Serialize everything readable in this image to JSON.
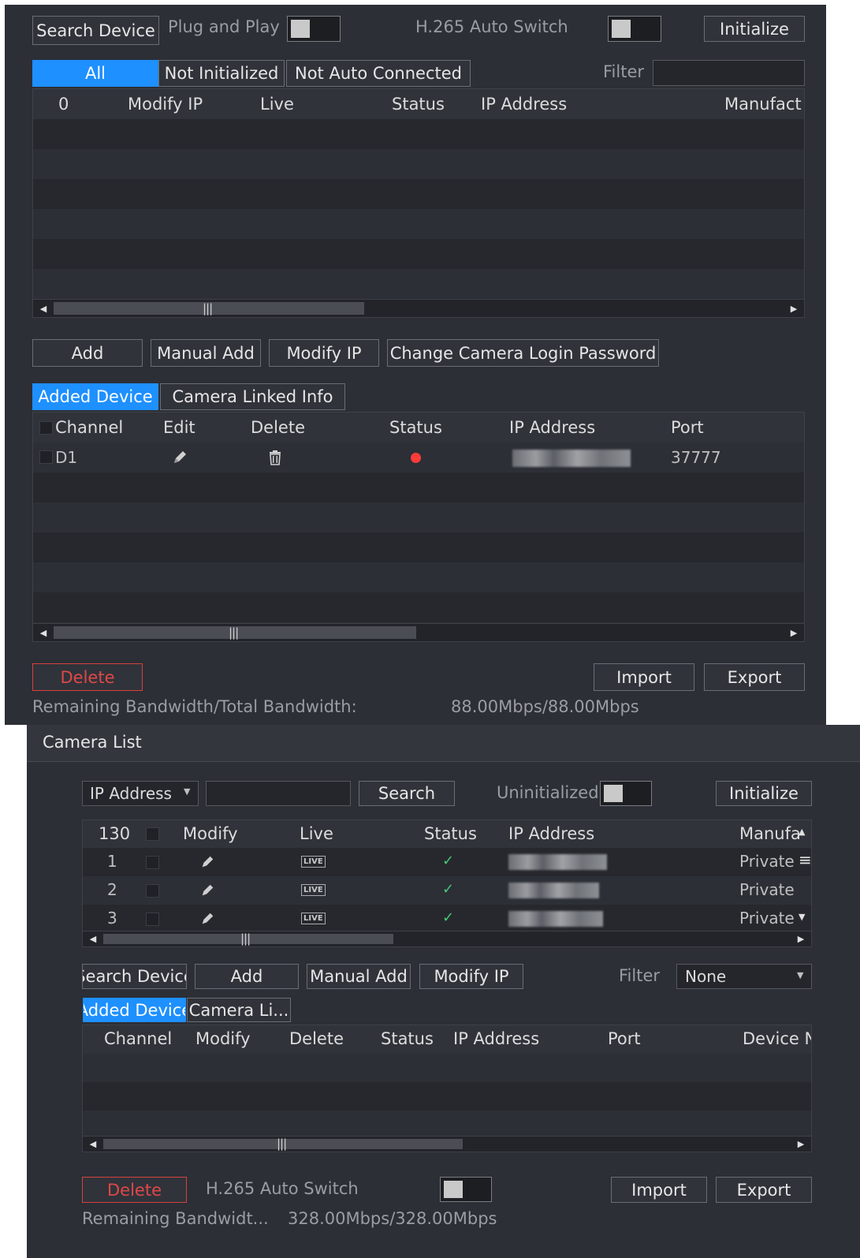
{
  "top": {
    "search_device": "Search Device",
    "plug_and_play": "Plug and Play",
    "h265_auto_switch": "H.265 Auto Switch",
    "initialize": "Initialize",
    "tabs": [
      "All",
      "Not Initialized",
      "Not Auto Connected"
    ],
    "filter_label": "Filter",
    "filter_value": "",
    "grid_headers": [
      "0",
      "Modify IP",
      "Live",
      "Status",
      "IP Address",
      "Manufact"
    ],
    "actions": [
      "Add",
      "Manual Add",
      "Modify IP",
      "Change Camera Login Password"
    ],
    "added_tabs": [
      "Added Device",
      "Camera Linked Info"
    ],
    "added_headers": [
      "Channel",
      "Edit",
      "Delete",
      "Status",
      "IP Address",
      "Port"
    ],
    "added_rows": [
      {
        "channel": "D1",
        "status": "offline",
        "status_color": "#ff3b3b",
        "port": "37777"
      }
    ],
    "delete": "Delete",
    "import": "Import",
    "export": "Export",
    "bandwidth_label": "Remaining Bandwidth/Total Bandwidth:",
    "bandwidth_value": "88.00Mbps/88.00Mbps"
  },
  "camera_list": {
    "title": "Camera List",
    "search_by": "IP Address",
    "search_value": "",
    "search_button": "Search",
    "uninitialized": "Uninitialized",
    "initialize": "Initialize",
    "grid_headers": [
      "130",
      "Modify",
      "Live",
      "Status",
      "IP Address",
      "Manufa"
    ],
    "rows": [
      {
        "index": "1",
        "live": "LIVE",
        "status": "✓",
        "manufacturer": "Private"
      },
      {
        "index": "2",
        "live": "LIVE",
        "status": "✓",
        "manufacturer": "Private"
      },
      {
        "index": "3",
        "live": "LIVE",
        "status": "✓",
        "manufacturer": "Private"
      }
    ],
    "actions": [
      "Search Device",
      "Add",
      "Manual Add",
      "Modify IP"
    ],
    "filter_label": "Filter",
    "filter_value": "None",
    "added_tabs": [
      "Added Device",
      "Camera Li..."
    ],
    "added_headers": [
      "Channel",
      "Modify",
      "Delete",
      "Status",
      "IP Address",
      "Port",
      "Device Na"
    ],
    "delete": "Delete",
    "h265_auto_switch": "H.265 Auto Switch",
    "import": "Import",
    "export": "Export",
    "bandwidth_label": "Remaining Bandwidt...",
    "bandwidth_value": "328.00Mbps/328.00Mbps"
  },
  "colors": {
    "accent": "#1e90ff",
    "danger": "#e04848",
    "ok": "#48c774",
    "panel": "#2c2f36"
  },
  "icons": [
    "pencil-icon",
    "trash-icon",
    "live-icon",
    "check-icon",
    "dropdown-arrow-icon",
    "scroll-left-icon",
    "scroll-right-icon",
    "scroll-up-icon",
    "scroll-down-icon",
    "menu-icon"
  ]
}
